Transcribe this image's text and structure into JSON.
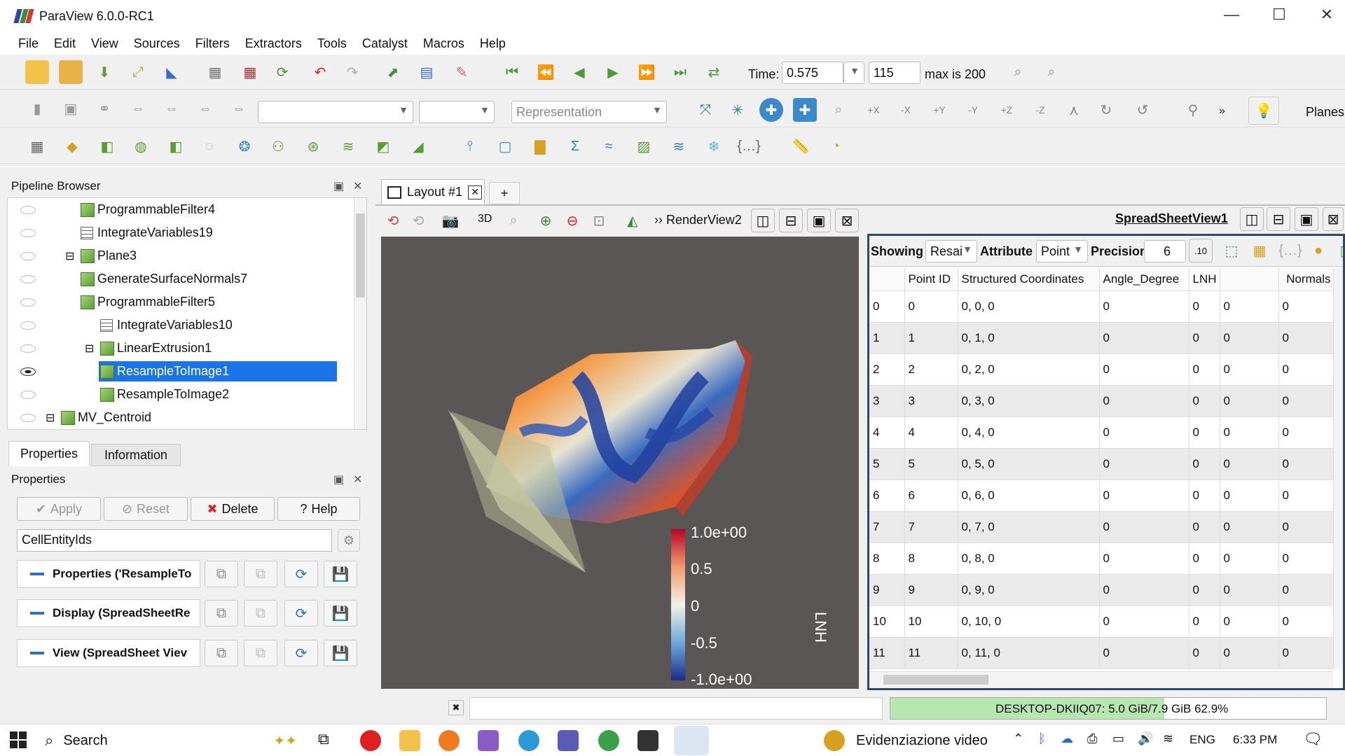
{
  "window": {
    "title": "ParaView 6.0.0-RC1",
    "minimize": "—",
    "maximize": "☐",
    "close": "✕"
  },
  "menu": [
    "File",
    "Edit",
    "View",
    "Sources",
    "Filters",
    "Extractors",
    "Tools",
    "Catalyst",
    "Macros",
    "Help"
  ],
  "time_toolbar": {
    "time_label": "Time:",
    "time_value": "0.575",
    "step_value": "115",
    "max_label": "max is 200"
  },
  "representation_toolbar": {
    "representation_placeholder": "Representation",
    "planes_label": "Planes",
    "more": "»"
  },
  "pipeline": {
    "title": "Pipeline Browser",
    "items": [
      {
        "label": "ProgrammableFilter4",
        "indent": 1,
        "icon": "cube-icon"
      },
      {
        "label": "IntegrateVariables19",
        "indent": 1,
        "icon": "spreadsheet-icon"
      },
      {
        "label": "Plane3",
        "indent": 1,
        "icon": "cube-icon",
        "expander": "⊟"
      },
      {
        "label": "GenerateSurfaceNormals7",
        "indent": 1,
        "icon": "cube-icon"
      },
      {
        "label": "ProgrammableFilter5",
        "indent": 1,
        "icon": "cube-icon"
      },
      {
        "label": "IntegrateVariables10",
        "indent": 2,
        "icon": "spreadsheet-icon"
      },
      {
        "label": "LinearExtrusion1",
        "indent": 2,
        "icon": "cube-icon",
        "expander": "⊟"
      },
      {
        "label": "ResampleToImage1",
        "indent": 2,
        "icon": "cube-icon",
        "selected": true
      },
      {
        "label": "ResampleToImage2",
        "indent": 2,
        "icon": "cube-icon"
      },
      {
        "label": "MV_Centroid",
        "indent": 0,
        "icon": "cube-icon",
        "expander": "⊟"
      }
    ]
  },
  "tabs": {
    "properties": "Properties",
    "information": "Information"
  },
  "properties": {
    "title": "Properties",
    "apply": "Apply",
    "reset": "Reset",
    "delete": "Delete",
    "help": "Help",
    "search_value": "CellEntityIds",
    "sections": [
      "Properties ('ResampleTo",
      "Display (SpreadSheetRe",
      "View (SpreadSheet Viev"
    ]
  },
  "layout": {
    "tab_label": "Layout #1",
    "add_tab": "+",
    "render_view": "RenderView2",
    "mode_3d": "3D",
    "spreadsheet_view": "SpreadSheetView1"
  },
  "colorbar": {
    "title": "LNH",
    "ticks": [
      "1.0e+00",
      "0.5",
      "0",
      "-0.5",
      "-1.0e+00"
    ]
  },
  "spreadsheet": {
    "showing_label": "Showing",
    "showing_value": "Resai",
    "attribute_label": "Attribute",
    "attribute_value": "Point",
    "precision_label": "Precision",
    "precision_value": "6",
    "columns": [
      "",
      "Point ID",
      "Structured Coordinates",
      "Angle_Degree",
      "LNH",
      "",
      "Normals",
      ""
    ],
    "rows": [
      [
        "0",
        "0",
        "0, 0, 0",
        "0",
        "0",
        "0",
        "0",
        "("
      ],
      [
        "1",
        "1",
        "0, 1, 0",
        "0",
        "0",
        "0",
        "0",
        "("
      ],
      [
        "2",
        "2",
        "0, 2, 0",
        "0",
        "0",
        "0",
        "0",
        "("
      ],
      [
        "3",
        "3",
        "0, 3, 0",
        "0",
        "0",
        "0",
        "0",
        "("
      ],
      [
        "4",
        "4",
        "0, 4, 0",
        "0",
        "0",
        "0",
        "0",
        "("
      ],
      [
        "5",
        "5",
        "0, 5, 0",
        "0",
        "0",
        "0",
        "0",
        "("
      ],
      [
        "6",
        "6",
        "0, 6, 0",
        "0",
        "0",
        "0",
        "0",
        "("
      ],
      [
        "7",
        "7",
        "0, 7, 0",
        "0",
        "0",
        "0",
        "0",
        "("
      ],
      [
        "8",
        "8",
        "0, 8, 0",
        "0",
        "0",
        "0",
        "0",
        "("
      ],
      [
        "9",
        "9",
        "0, 9, 0",
        "0",
        "0",
        "0",
        "0",
        "("
      ],
      [
        "10",
        "10",
        "0, 10, 0",
        "0",
        "0",
        "0",
        "0",
        "("
      ],
      [
        "11",
        "11",
        "0, 11, 0",
        "0",
        "0",
        "0",
        "0",
        "("
      ]
    ]
  },
  "statusbar": {
    "memory": "DESKTOP-DKIIQ07: 5.0 GiB/7.9 GiB 62.9%",
    "memory_fraction": 0.629
  },
  "taskbar": {
    "search": "Search",
    "notification": "Evidenziazione video",
    "language": "ENG",
    "clock": "6:33 PM"
  }
}
